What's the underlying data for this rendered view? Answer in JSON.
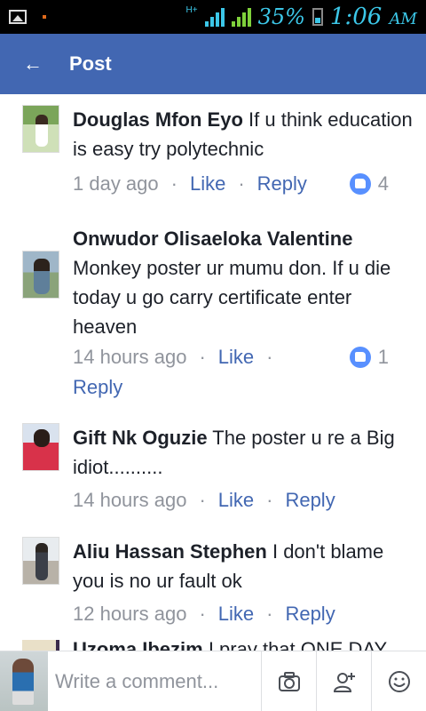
{
  "status_bar": {
    "network": "H+",
    "battery": "35%",
    "time": "1:06",
    "ampm": "AM"
  },
  "header": {
    "title": "Post"
  },
  "comments": [
    {
      "author": "Douglas Mfon Eyo",
      "text": "If u think education is easy try polytechnic",
      "time": "1 day ago",
      "like_label": "Like",
      "reply_label": "Reply",
      "reactions": "4"
    },
    {
      "author": "Onwudor Olisaeloka Valentine",
      "text": "Monkey poster ur mumu don. If u die today u go carry certificate enter heaven",
      "time": "14 hours ago",
      "like_label": "Like",
      "reply_label": "Reply",
      "reactions": "1"
    },
    {
      "author": "Gift Nk Oguzie",
      "text": "The  poster  u re  a Big  idiot..........",
      "time": "14 hours ago",
      "like_label": "Like",
      "reply_label": "Reply"
    },
    {
      "author": "Aliu Hassan Stephen",
      "text": "I don't  blame you is no ur fault  ok",
      "time": "12 hours ago",
      "like_label": "Like",
      "reply_label": "Reply"
    }
  ],
  "partial_comment": {
    "author": "Uzoma Ibezim",
    "text": "I pray that ONE DAY"
  },
  "composer": {
    "placeholder": "Write a comment..."
  },
  "colors": {
    "brand": "#4267b2",
    "like_badge": "#5890ff"
  },
  "icons": [
    "back-arrow-icon",
    "camera-icon",
    "add-friend-icon",
    "emoji-icon",
    "like-reaction-icon"
  ]
}
